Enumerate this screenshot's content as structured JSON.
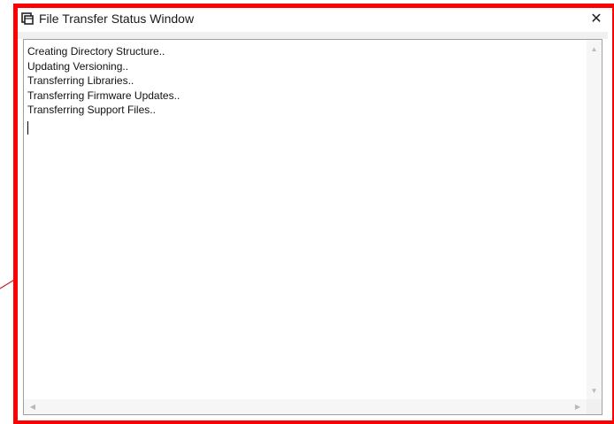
{
  "window": {
    "title": "File Transfer Status Window",
    "icon": "app-window-icon",
    "close_label": "✕"
  },
  "log": {
    "lines": [
      "Creating Directory Structure..",
      "Updating Versioning..",
      "Transferring Libraries..",
      "Transferring Firmware Updates..",
      "Transferring Support Files.."
    ]
  },
  "scrollbars": {
    "up_arrow": "▲",
    "down_arrow": "▼",
    "left_arrow": "◀",
    "right_arrow": "▶"
  },
  "colors": {
    "highlight": "#ff0000",
    "window_bg": "#ffffff",
    "text": "#111111"
  }
}
